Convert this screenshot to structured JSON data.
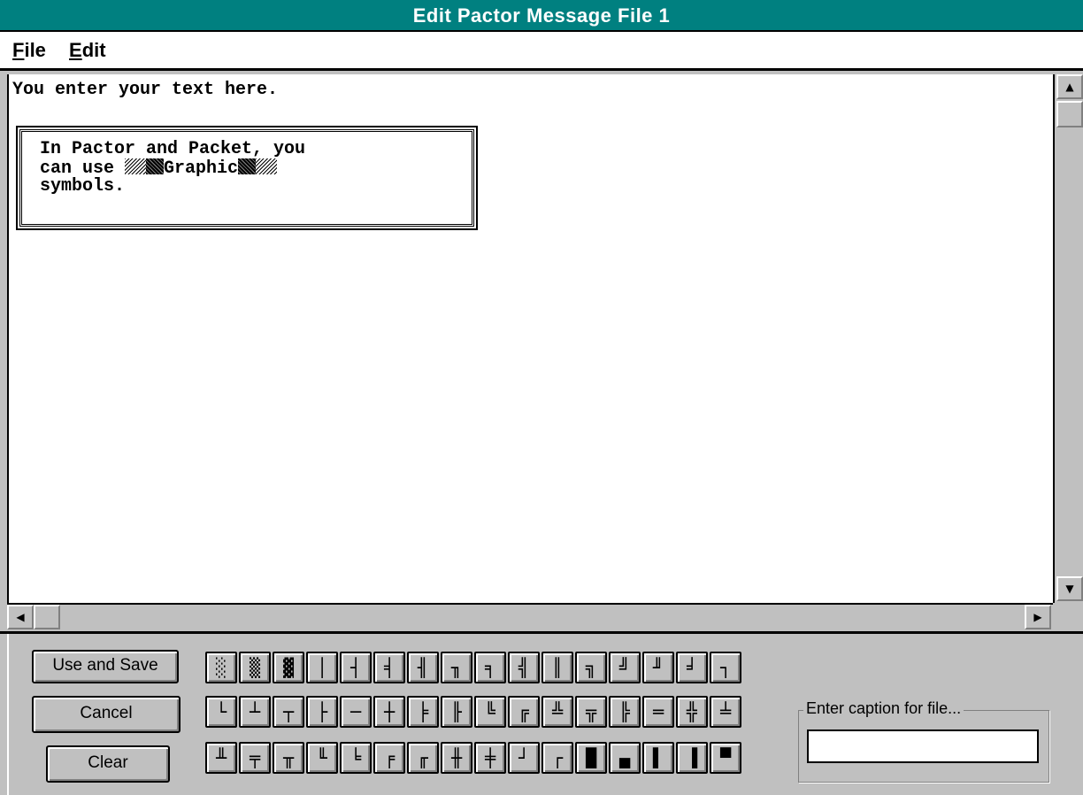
{
  "window": {
    "title": "Edit Pactor Message File  1"
  },
  "menu": {
    "file": {
      "accel": "F",
      "rest": "ile"
    },
    "edit": {
      "accel": "E",
      "rest": "dit"
    }
  },
  "editor": {
    "line1": "You enter your text here.",
    "box_line1": "In Pactor and Packet, you",
    "box_line2_pre": "can use ",
    "box_line2_word": "Graphic",
    "box_line3": "symbols."
  },
  "scrollbars": {
    "up_arrow": "▲",
    "down_arrow": "▼",
    "left_arrow": "◀",
    "right_arrow": "▶"
  },
  "buttons": {
    "use_and_save": "Use and Save",
    "cancel": "Cancel",
    "clear": "Clear"
  },
  "graphic_rows": [
    [
      "░",
      "▒",
      "▓",
      "│",
      "┤",
      "╡",
      "╢",
      "╖",
      "╕",
      "╣",
      "║",
      "╗",
      "╝",
      "╜",
      "╛",
      "┐"
    ],
    [
      "└",
      "┴",
      "┬",
      "├",
      "─",
      "┼",
      "╞",
      "╟",
      "╚",
      "╔",
      "╩",
      "╦",
      "╠",
      "═",
      "╬",
      "╧"
    ],
    [
      "╨",
      "╤",
      "╥",
      "╙",
      "╘",
      "╒",
      "╓",
      "╫",
      "╪",
      "┘",
      "┌",
      "█",
      "▄",
      "▌",
      "▐",
      "▀"
    ]
  ],
  "caption": {
    "label": "Enter caption for file...",
    "value": ""
  }
}
